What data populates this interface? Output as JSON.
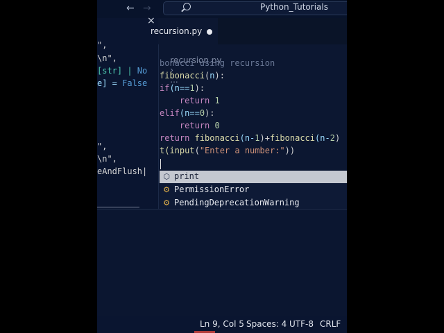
{
  "titlebar": {
    "search_text": "Python_Tutorials",
    "back_icon": "←",
    "forward_icon": "→"
  },
  "left_panel": {
    "close_icon": "×",
    "lines": [
      {
        "text": "\","
      },
      {
        "text": "\\n\","
      },
      {
        "a": "[str] | ",
        "b": "No"
      },
      {
        "a": "e] = ",
        "b": "False"
      },
      {
        "text": "\","
      },
      {
        "text": "\\n\","
      },
      {
        "text": "eAndFlush|"
      }
    ]
  },
  "tab": {
    "name": "recursion.py"
  },
  "breadcrumb": {
    "file": "recursion.py",
    "sep": "›",
    "more": "..."
  },
  "code_lines": [
    {
      "comment": "bonacci using recursion"
    },
    {
      "fn": "fibonacci",
      "rest": "(",
      "var": "n",
      "end": "):"
    },
    {
      "kw": "if",
      "rest": "(n==",
      "num": "1",
      "end": "):"
    },
    {
      "indent": "    ",
      "kw": "return",
      "num": " 1"
    },
    {
      "kw": "elif",
      "rest": "(n==",
      "num": "0",
      "end": "):"
    },
    {
      "indent": "    ",
      "kw": "return",
      "num": " 0"
    },
    {
      "kw": "return",
      "f1": " fibonacci",
      "p1": "(n-",
      "n1": "1",
      "p2": ")+",
      "f2": "fibonacci",
      "p3": "(n-",
      "n2": "2",
      "p4": ")"
    },
    {
      "pre": "t(",
      "fn": "input",
      "p": "(",
      "str": "\"Enter a number:\"",
      "end": "))"
    }
  ],
  "suggestions": [
    {
      "label": "print",
      "icon": "cube-icon",
      "glyph": "⬡",
      "selected": true
    },
    {
      "label": "PermissionError",
      "icon": "class-icon",
      "glyph": "⚙",
      "selected": false
    },
    {
      "label": "PendingDeprecationWarning",
      "icon": "class-icon",
      "glyph": "⚙",
      "selected": false
    }
  ],
  "statusbar": {
    "position": "Ln 9, Col 5",
    "spaces": "Spaces: 4",
    "encoding": "UTF-8",
    "eol": "CRLF"
  }
}
